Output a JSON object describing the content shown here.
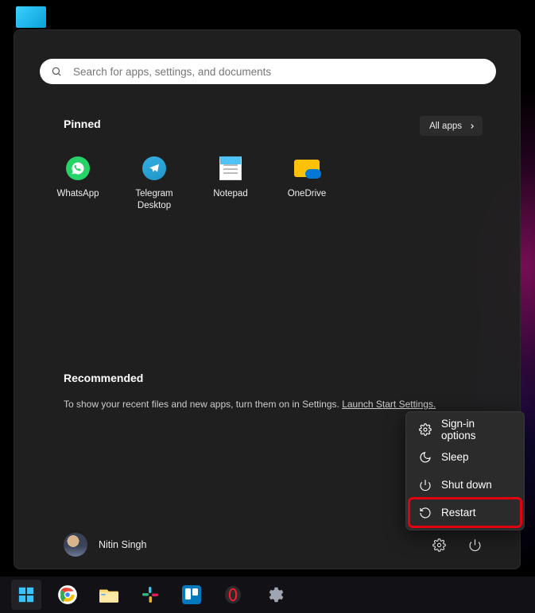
{
  "search": {
    "placeholder": "Search for apps, settings, and documents"
  },
  "pinned": {
    "title": "Pinned",
    "all_apps_label": "All apps",
    "items": [
      {
        "label": "WhatsApp",
        "icon": "whatsapp-icon"
      },
      {
        "label": "Telegram\nDesktop",
        "icon": "telegram-icon"
      },
      {
        "label": "Notepad",
        "icon": "notepad-icon"
      },
      {
        "label": "OneDrive",
        "icon": "onedrive-icon"
      }
    ]
  },
  "recommended": {
    "title": "Recommended",
    "text": "To show your recent files and new apps, turn them on in Settings. ",
    "link_label": "Launch Start Settings."
  },
  "power_menu": {
    "items": [
      {
        "label": "Sign-in options",
        "icon": "gear-icon"
      },
      {
        "label": "Sleep",
        "icon": "moon-icon"
      },
      {
        "label": "Shut down",
        "icon": "power-icon"
      },
      {
        "label": "Restart",
        "icon": "restart-icon",
        "highlighted": true
      }
    ]
  },
  "user": {
    "name": "Nitin Singh"
  },
  "taskbar": {
    "items": [
      {
        "name": "start-button",
        "icon": "windows-icon",
        "active": true
      },
      {
        "name": "chrome-button",
        "icon": "chrome-icon"
      },
      {
        "name": "explorer-button",
        "icon": "explorer-icon"
      },
      {
        "name": "slack-button",
        "icon": "slack-icon"
      },
      {
        "name": "trello-button",
        "icon": "trello-icon"
      },
      {
        "name": "opera-button",
        "icon": "opera-icon"
      },
      {
        "name": "settings-button",
        "icon": "settings-icon"
      }
    ]
  }
}
